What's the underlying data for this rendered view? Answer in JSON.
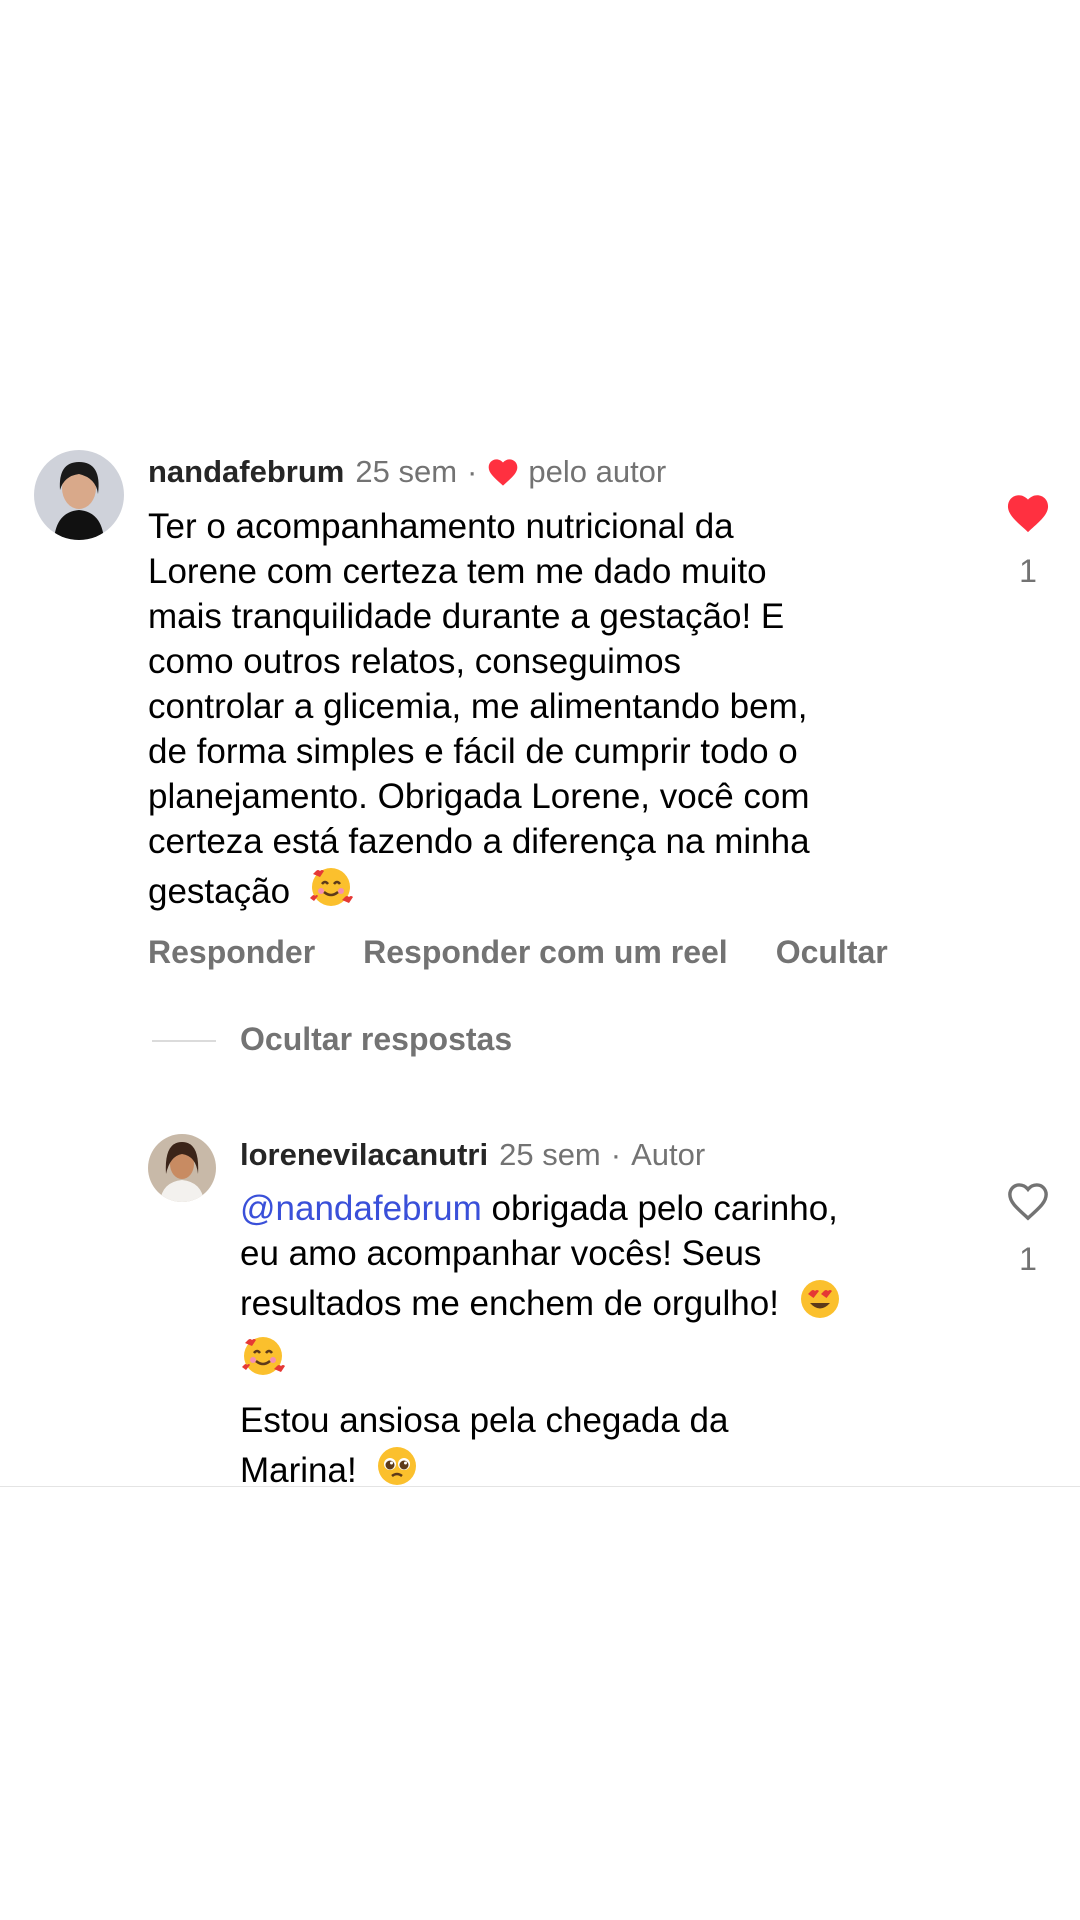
{
  "comment": {
    "username": "nandafebrum",
    "time": "25 sem",
    "dot": "·",
    "liked_by_author_label": "pelo autor",
    "lines": [
      "Ter o acompanhamento nutricional da",
      "Lorene com certeza tem me dado muito",
      "mais tranquilidade durante a gestação! E",
      "como outros relatos, conseguimos",
      "controlar a glicemia, me alimentando bem,",
      "de forma simples e fácil de cumprir todo o",
      "planejamento. Obrigada Lorene, você com",
      "certeza está fazendo a diferença na minha",
      "gestação"
    ],
    "emoji_name": "smiling-face-with-hearts",
    "like_count": "1",
    "liked": true,
    "actions": {
      "reply": "Responder",
      "reply_reel": "Responder com um reel",
      "hide": "Ocultar"
    },
    "hide_replies": "Ocultar respostas"
  },
  "reply": {
    "username": "lorenevilacanutri",
    "time": "25 sem",
    "dot": "·",
    "author_label": "Autor",
    "mention": "@nandafebrum",
    "line1_rest": " obrigada pelo carinho,",
    "lines": [
      "eu amo acompanhar vocês! Seus",
      "resultados me enchem de orgulho!"
    ],
    "line5": "Estou ansiosa pela chegada da",
    "line6": "Marina!",
    "like_count": "1",
    "liked": false
  },
  "colors": {
    "heart_red": "#ff3040",
    "muted": "#737373",
    "mention_blue": "#3a50d9"
  }
}
